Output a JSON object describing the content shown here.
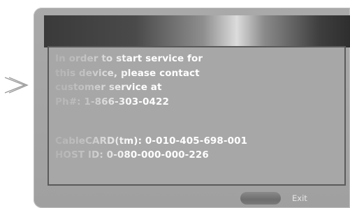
{
  "dialog": {
    "message": {
      "line1": "In order to start service for",
      "line2": "this device, please contact",
      "line3": "customer service at",
      "line4": "Ph#: 1-866-303-0422"
    },
    "ids": {
      "cablecard": "CableCARD(tm): 0-010-405-698-001",
      "host": "HOST ID: 0-080-000-000-226"
    },
    "exit_label": "Exit"
  },
  "colors": {
    "panel": "#a5a5a5",
    "text": "#ffffff",
    "title_bar_dark": "#3a3a3a",
    "title_bar_highlight": "#dcdcdc"
  },
  "icons": {
    "pointer": "double-chevron-right-icon"
  }
}
